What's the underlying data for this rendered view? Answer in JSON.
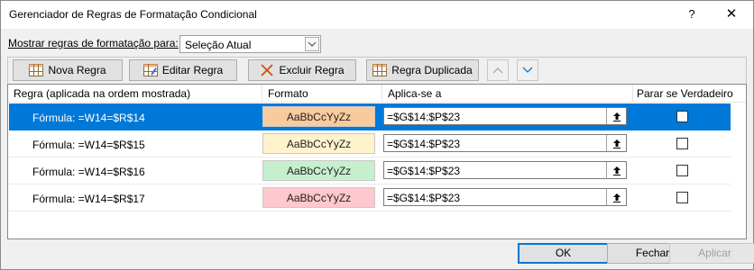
{
  "window": {
    "title": "Gerenciador de Regras de Formatação Condicional",
    "help": "?",
    "close": "✕"
  },
  "show_rules": {
    "label": "Mostrar regras de formatação para:",
    "selected": "Seleção Atual"
  },
  "toolbar": {
    "new_rule": "Nova Regra",
    "edit_rule": "Editar Regra",
    "delete_rule": "Excluir Regra",
    "duplicate_rule": "Regra Duplicada"
  },
  "columns": {
    "rule": "Regra (aplicada na ordem mostrada)",
    "format": "Formato",
    "applies_to": "Aplica-se a",
    "stop_if_true": "Parar se Verdadeiro"
  },
  "rules": [
    {
      "rule": "Fórmula: =W14=$R$14",
      "preview": "AaBbCcYyZz",
      "applies_to": "=$G$14:$P$23",
      "color": "#f9cb9c",
      "stop": false,
      "selected": true
    },
    {
      "rule": "Fórmula: =W14=$R$15",
      "preview": "AaBbCcYyZz",
      "applies_to": "=$G$14:$P$23",
      "color": "#fff2cc",
      "stop": false,
      "selected": false
    },
    {
      "rule": "Fórmula: =W14=$R$16",
      "preview": "AaBbCcYyZz",
      "applies_to": "=$G$14:$P$23",
      "color": "#c6efce",
      "stop": false,
      "selected": false
    },
    {
      "rule": "Fórmula: =W14=$R$17",
      "preview": "AaBbCcYyZz",
      "applies_to": "=$G$14:$P$23",
      "color": "#ffc7ce",
      "stop": false,
      "selected": false
    }
  ],
  "buttons": {
    "ok": "OK",
    "close": "Fechar",
    "apply": "Aplicar"
  },
  "colors": {
    "selection": "#0078d7"
  }
}
